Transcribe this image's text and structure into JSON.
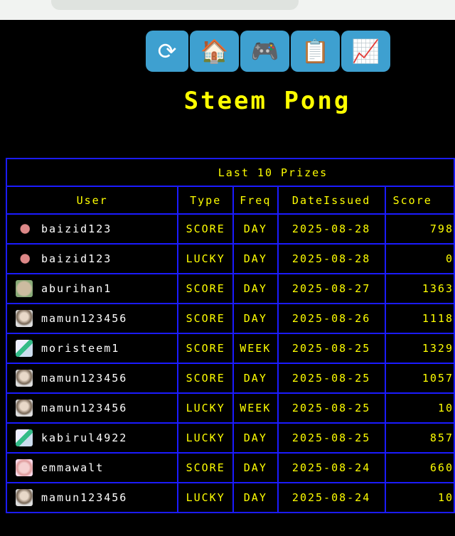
{
  "nav": [
    {
      "icon": "⟳",
      "name": "refresh"
    },
    {
      "icon": "🏠",
      "name": "home"
    },
    {
      "icon": "🎮",
      "name": "game"
    },
    {
      "icon": "📋",
      "name": "clipboard"
    },
    {
      "icon": "📈",
      "name": "chart"
    }
  ],
  "title": "Steem Pong",
  "table": {
    "caption": "Last 10 Prizes",
    "headers": [
      "User",
      "Type",
      "Freq",
      "DateIssued",
      "Score"
    ],
    "rows": [
      {
        "avatar": "pig",
        "user": "baizid123",
        "type": "SCORE",
        "freq": "DAY",
        "date": "2025-08-28",
        "score": "798"
      },
      {
        "avatar": "pig",
        "user": "baizid123",
        "type": "LUCKY",
        "freq": "DAY",
        "date": "2025-08-28",
        "score": "0"
      },
      {
        "avatar": "tan",
        "user": "aburihan1",
        "type": "SCORE",
        "freq": "DAY",
        "date": "2025-08-27",
        "score": "1363"
      },
      {
        "avatar": "face",
        "user": "mamun123456",
        "type": "SCORE",
        "freq": "DAY",
        "date": "2025-08-26",
        "score": "1118"
      },
      {
        "avatar": "green",
        "user": "moristeem1",
        "type": "SCORE",
        "freq": "WEEK",
        "date": "2025-08-25",
        "score": "1329"
      },
      {
        "avatar": "face",
        "user": "mamun123456",
        "type": "SCORE",
        "freq": "DAY",
        "date": "2025-08-25",
        "score": "1057"
      },
      {
        "avatar": "face",
        "user": "mamun123456",
        "type": "LUCKY",
        "freq": "WEEK",
        "date": "2025-08-25",
        "score": "10"
      },
      {
        "avatar": "green",
        "user": "kabirul4922",
        "type": "LUCKY",
        "freq": "DAY",
        "date": "2025-08-25",
        "score": "857"
      },
      {
        "avatar": "pink",
        "user": "emmawalt",
        "type": "SCORE",
        "freq": "DAY",
        "date": "2025-08-24",
        "score": "660"
      },
      {
        "avatar": "face",
        "user": "mamun123456",
        "type": "LUCKY",
        "freq": "DAY",
        "date": "2025-08-24",
        "score": "10"
      }
    ]
  }
}
